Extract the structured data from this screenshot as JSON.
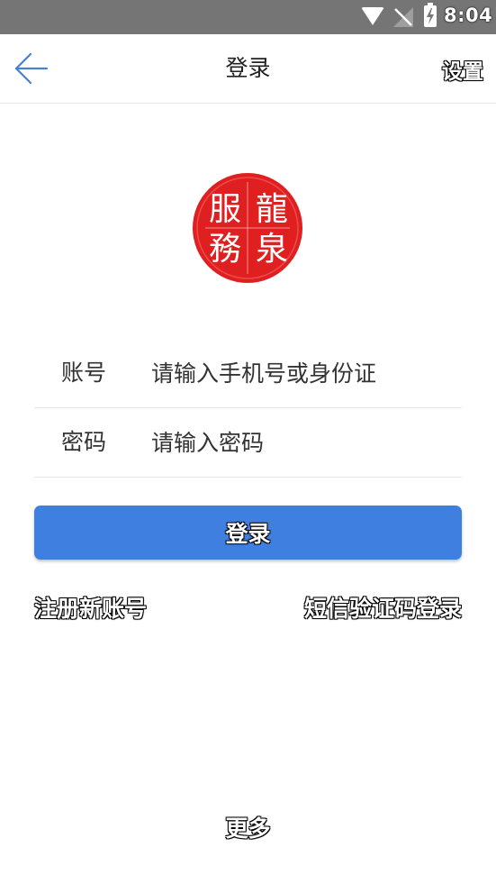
{
  "status_bar": {
    "time": "8:04",
    "icons": [
      "wifi-icon",
      "no-signal-icon",
      "battery-charging-icon"
    ]
  },
  "header": {
    "back_icon": "arrow-left-icon",
    "title": "登录",
    "settings_label": "设置"
  },
  "logo": {
    "icon": "seal-logo",
    "text": "龍泉服務",
    "color": "#e02020"
  },
  "form": {
    "account_label": "账号",
    "account_placeholder": "请输入手机号或身份证",
    "account_value": "",
    "password_label": "密码",
    "password_placeholder": "请输入密码",
    "password_value": ""
  },
  "actions": {
    "login_label": "登录",
    "register_label": "注册新账号",
    "sms_login_label": "短信验证码登录",
    "more_label": "更多"
  },
  "colors": {
    "accent": "#3e7fe0",
    "status_bar": "#757575"
  }
}
